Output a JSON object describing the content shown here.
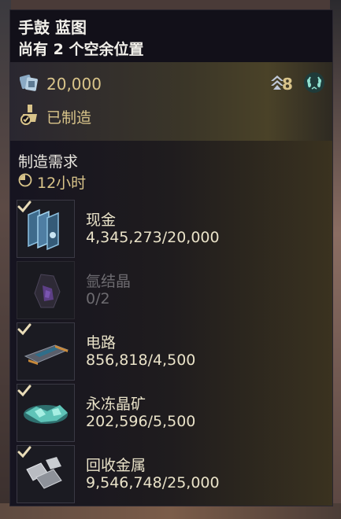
{
  "header": {
    "title": "手鼓 蓝图",
    "subtitle": "尚有 2 个空余位置"
  },
  "info": {
    "price": "20,000",
    "price_icon": "currency-icon",
    "rank": "8",
    "rank_icon": "rank-chevron-icon",
    "laurel_icon": "laurel-icon",
    "crafted_label": "已制造",
    "crafted_icon": "crafted-icon"
  },
  "requirements": {
    "title": "制造需求",
    "time": "12小时",
    "materials": [
      {
        "name": "现金",
        "count": "4,345,273/20,000",
        "icon": "cash-icon",
        "satisfied": true
      },
      {
        "name": "氩结晶",
        "count": "0/2",
        "icon": "argon-crystal-icon",
        "satisfied": false
      },
      {
        "name": "电路",
        "count": "856,818/4,500",
        "icon": "circuit-icon",
        "satisfied": true
      },
      {
        "name": "永冻晶矿",
        "count": "202,596/5,500",
        "icon": "permafrost-ore-icon",
        "satisfied": true
      },
      {
        "name": "回收金属",
        "count": "9,546,748/25,000",
        "icon": "recycled-metal-icon",
        "satisfied": true
      }
    ]
  },
  "colors": {
    "panel_bg": "#121019",
    "accent_gold": "#d9c48a",
    "text_light": "#e9e2c8",
    "text_dim": "#6d6b70"
  }
}
